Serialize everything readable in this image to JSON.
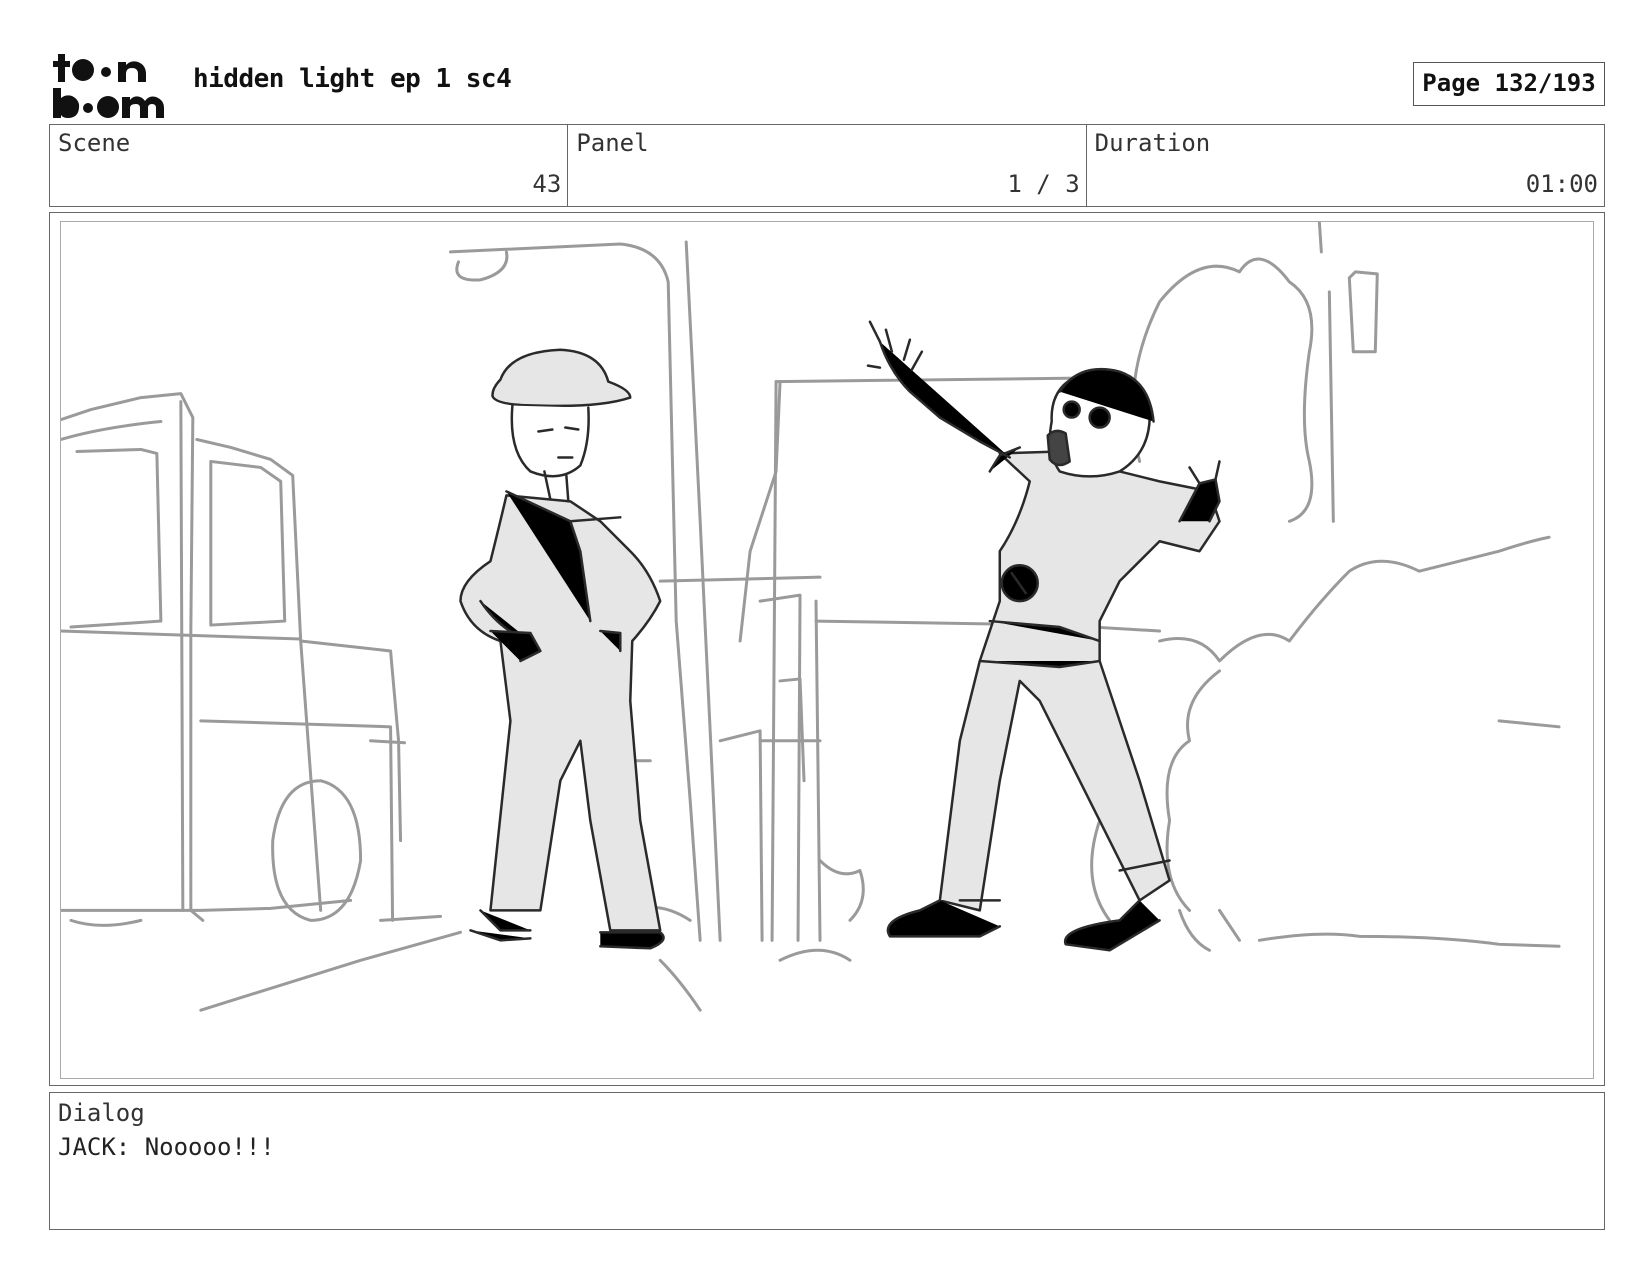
{
  "header": {
    "logo_text": "toonboom",
    "title": "hidden light ep 1 sc4",
    "page": "Page 132/193"
  },
  "info": {
    "scene_label": "Scene",
    "scene_value": "43",
    "panel_label": "Panel",
    "panel_value": "1 / 3",
    "duration_label": "Duration",
    "duration_value": "01:00"
  },
  "dialog": {
    "label": "Dialog",
    "text": "JACK: Nooooo!!!"
  },
  "icons": {
    "logo": "toon-boom-logo"
  },
  "colors": {
    "sketch_gray": "#9a9a9a",
    "ink": "#2a2a2a",
    "fill": "#e6e6e6"
  }
}
